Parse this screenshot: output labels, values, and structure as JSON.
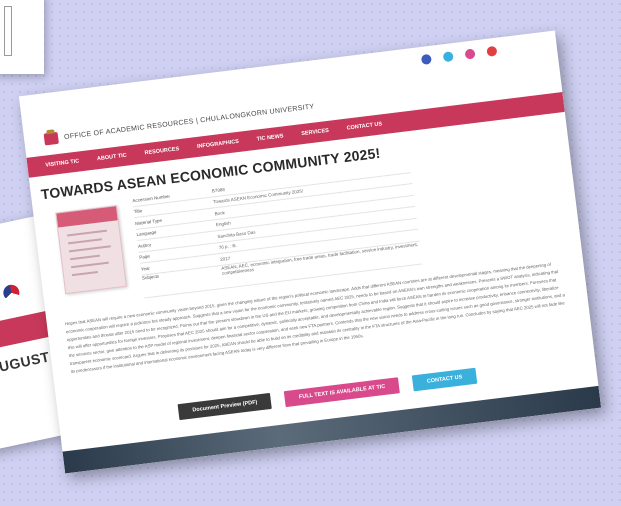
{
  "site": {
    "name": "OFFICE OF ACADEMIC RESOURCES | CHULALONGKORN UNIVERSITY"
  },
  "nav": [
    "VISITING TIC",
    "ABOUT TIC",
    "RESOURCES",
    "INFOGRAPHICS",
    "TIC NEWS",
    "SERVICES",
    "CONTACT US"
  ],
  "page_title": "TOWARDS ASEAN ECONOMIC COMMUNITY 2025!",
  "metadata": {
    "rows": [
      {
        "label": "Accession Number",
        "value": "B7988"
      },
      {
        "label": "Title",
        "value": "Towards ASEAN Economic Community 2025!"
      },
      {
        "label": "Material Type",
        "value": "Book"
      },
      {
        "label": "Language",
        "value": "English"
      },
      {
        "label": "Author",
        "value": "Sanchita Basu Das"
      },
      {
        "label": "Page",
        "value": "76 p. : ill."
      },
      {
        "label": "Year",
        "value": "2017"
      },
      {
        "label": "Subjects",
        "value": "ASEAN, AEC, economic integration, free trade areas, trade facilitation, service industry, investment, competitiveness"
      }
    ]
  },
  "abstract": "Hopes that ASEAN will require a new economic community vision beyond 2015, given the changing nature of the region's political economic landscape. Adds that different ASEAN countries are at different developmental stages, meaning that the deepening of economic cooperation will require a judicious but steady approach. Suggests that a new vision for the economic community, tentatively named AEC 2025, needs to be based on ASEAN's own strengths and weaknesses. Presents a SWOT analysis, indicating that opportunities and threats after 2015 need to be recognized. Points out that the present slowdown in the US and the EU markets, growing competition from China and India will force ASEAN to harden its economic cooperation among its members. Foresees that this will offer opportunities for foreign investors. Proposes that AEC 2025 should aim for a competitive, dynamic, politically acceptable, and developmentally achievable region. Suggests that it should aspire to increase productivity, enhance connectivity, liberalize the services sector, give attention to the ASP model of regional investment, deepen financial sector cooperation, and seek new FTA partners. Contends that the new vision needs to address cross-cutting issues such as good governance, stronger institutions, and a transparent economic scorecard. Argues that in delivering its promises for 2025, ASEAN should be able to build on its credibility and maintain its centrality in the FTA structures of the Asia-Pacific in the long run. Concludes by saying that AEC 2025 will not fade like its predecessors if the institutional and international economic environment facing ASEAN today is very different from that prevailing in Europe in the 1950s.",
  "buttons": {
    "preview": "Document Preview (PDF)",
    "fulltext": "FULL TEXT IS AVAILABLE AT TIC",
    "contact": "CONTACT US"
  },
  "side_card": {
    "month": "AUGUST"
  },
  "colors": {
    "accent": "#c8385a",
    "background": "#cfd0f2",
    "preview_button": "#3a3a3a",
    "fulltext_button": "#d94a8c",
    "contact_button": "#3ab0dc"
  },
  "icons": [
    "facebook-icon",
    "twitter-icon",
    "instagram-icon",
    "youtube-icon"
  ]
}
